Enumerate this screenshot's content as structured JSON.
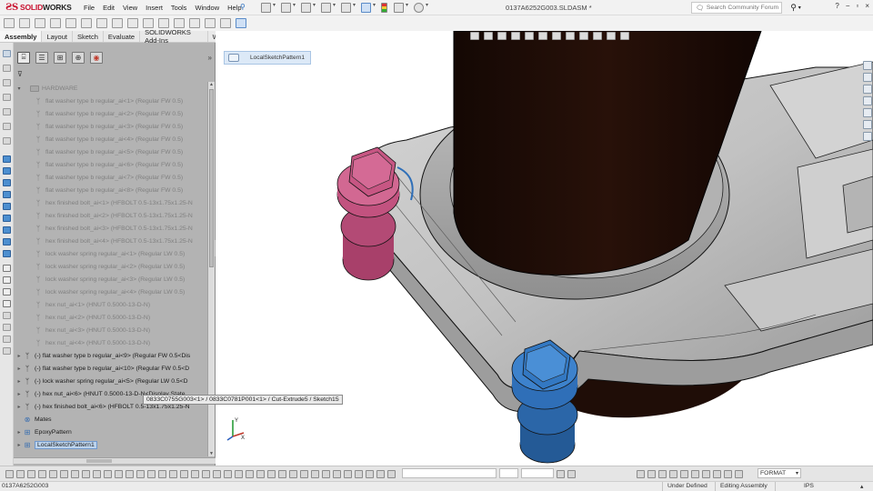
{
  "app": {
    "logo_solid": "SOLID",
    "logo_works": "WORKS",
    "document_title": "0137A6252G003.SLDASM *"
  },
  "menus": [
    "File",
    "Edit",
    "View",
    "Insert",
    "Tools",
    "Window",
    "Help"
  ],
  "search": {
    "placeholder": "Search Community Forum"
  },
  "command_tabs": [
    {
      "label": "Assembly",
      "active": true
    },
    {
      "label": "Layout",
      "active": false
    },
    {
      "label": "Sketch",
      "active": false
    },
    {
      "label": "Evaluate",
      "active": false
    },
    {
      "label": "SOLIDWORKS Add-Ins",
      "active": false
    },
    {
      "label": "Weldments",
      "active": false
    }
  ],
  "tree": [
    {
      "label": "HARDWARE",
      "type": "folder",
      "state": "dim",
      "indent": 1,
      "toggle": "▾"
    },
    {
      "label": "flat washer type b regular_ai<1> (Regular FW 0.5)",
      "type": "part",
      "state": "dim",
      "indent": 2
    },
    {
      "label": "flat washer type b regular_ai<2> (Regular FW 0.5)",
      "type": "part",
      "state": "dim",
      "indent": 2
    },
    {
      "label": "flat washer type b regular_ai<3> (Regular FW 0.5)",
      "type": "part",
      "state": "dim",
      "indent": 2
    },
    {
      "label": "flat washer type b regular_ai<4> (Regular FW 0.5)",
      "type": "part",
      "state": "dim",
      "indent": 2
    },
    {
      "label": "flat washer type b regular_ai<5> (Regular FW 0.5)",
      "type": "part",
      "state": "dim",
      "indent": 2
    },
    {
      "label": "flat washer type b regular_ai<6> (Regular FW 0.5)",
      "type": "part",
      "state": "dim",
      "indent": 2
    },
    {
      "label": "flat washer type b regular_ai<7> (Regular FW 0.5)",
      "type": "part",
      "state": "dim",
      "indent": 2
    },
    {
      "label": "flat washer type b regular_ai<8> (Regular FW 0.5)",
      "type": "part",
      "state": "dim",
      "indent": 2
    },
    {
      "label": "hex finished bolt_ai<1> (HFBOLT 0.5-13x1.75x1.25-N",
      "type": "part",
      "state": "dim",
      "indent": 2
    },
    {
      "label": "hex finished bolt_ai<2> (HFBOLT 0.5-13x1.75x1.25-N",
      "type": "part",
      "state": "dim",
      "indent": 2
    },
    {
      "label": "hex finished bolt_ai<3> (HFBOLT 0.5-13x1.75x1.25-N",
      "type": "part",
      "state": "dim",
      "indent": 2
    },
    {
      "label": "hex finished bolt_ai<4> (HFBOLT 0.5-13x1.75x1.25-N",
      "type": "part",
      "state": "dim",
      "indent": 2
    },
    {
      "label": "lock washer spring regular_ai<1> (Regular LW 0.5)",
      "type": "part",
      "state": "dim",
      "indent": 2
    },
    {
      "label": "lock washer spring regular_ai<2> (Regular LW 0.5)",
      "type": "part",
      "state": "dim",
      "indent": 2
    },
    {
      "label": "lock washer spring regular_ai<3> (Regular LW 0.5)",
      "type": "part",
      "state": "dim",
      "indent": 2
    },
    {
      "label": "lock washer spring regular_ai<4> (Regular LW 0.5)",
      "type": "part",
      "state": "dim",
      "indent": 2
    },
    {
      "label": "hex nut_ai<1> (HNUT 0.5000-13-D-N)",
      "type": "part",
      "state": "dim",
      "indent": 2
    },
    {
      "label": "hex nut_ai<2> (HNUT 0.5000-13-D-N)",
      "type": "part",
      "state": "dim",
      "indent": 2
    },
    {
      "label": "hex nut_ai<3> (HNUT 0.5000-13-D-N)",
      "type": "part",
      "state": "dim",
      "indent": 2
    },
    {
      "label": "hex nut_ai<4> (HNUT 0.5000-13-D-N)",
      "type": "part",
      "state": "dim",
      "indent": 2
    },
    {
      "label": "(-) flat washer type b regular_ai<9> (Regular FW 0.5<Dis",
      "type": "part",
      "state": "on",
      "indent": 0,
      "toggle": "▸"
    },
    {
      "label": "(-) flat washer type b regular_ai<10> (Regular FW 0.5<D",
      "type": "part",
      "state": "on",
      "indent": 0,
      "toggle": "▸"
    },
    {
      "label": "(-) lock washer spring regular_ai<5> (Regular LW 0.5<D",
      "type": "part",
      "state": "on",
      "indent": 0,
      "toggle": "▸"
    },
    {
      "label": "(-) hex nut_ai<6> (HNUT 0.5000-13-D-N<Display State",
      "type": "part",
      "state": "on",
      "indent": 0,
      "toggle": "▸"
    },
    {
      "label": "(-) hex finished bolt_ai<6> (HFBOLT 0.5-13x1.75x1.25-N",
      "type": "part",
      "state": "on",
      "indent": 0,
      "toggle": "▸"
    },
    {
      "label": "Mates",
      "type": "mates",
      "state": "on",
      "indent": 0
    },
    {
      "label": "EpoxyPattern",
      "type": "pattern",
      "state": "on",
      "indent": 0,
      "toggle": "▸"
    },
    {
      "label": "LocalSketchPattern1",
      "type": "pattern",
      "state": "on",
      "indent": 0,
      "toggle": "▸",
      "selected": true
    }
  ],
  "tooltip": "0833C0755G003<1> / 0833C0781P001<1> / Cut-Extrude5 / Sketch15",
  "breadcrumb": "LocalSketchPattern1",
  "triad": {
    "x": "X",
    "y": "Y"
  },
  "format_combo": "FORMAT",
  "status": {
    "document": "0137A6252G003",
    "defined": "Under Defined",
    "mode": "Editing Assembly",
    "units": "IPS"
  },
  "colors": {
    "bolt_magenta": "#c2527f",
    "bolt_blue": "#2f6fb8",
    "cylinder": "#1f0d07",
    "housing": "#c3c3c3",
    "selection": "#bcd3ec"
  }
}
